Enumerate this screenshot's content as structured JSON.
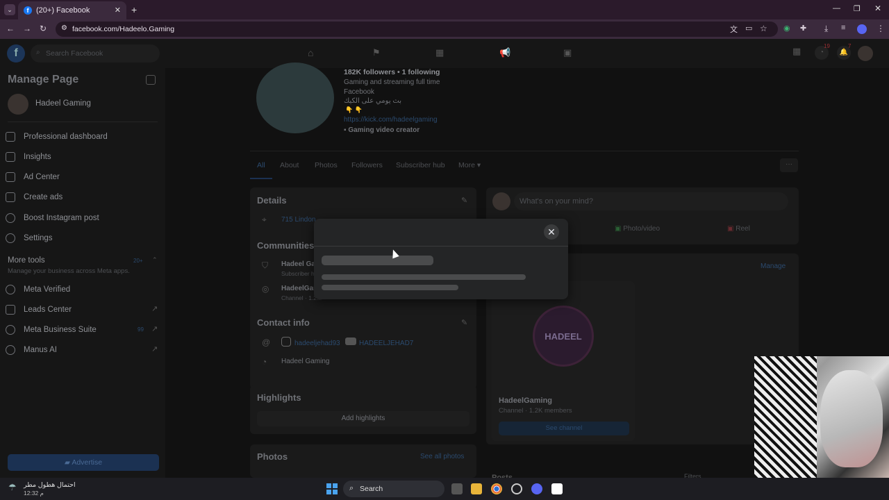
{
  "browser": {
    "tab_title": "(20+) Facebook",
    "url": "facebook.com/Hadeelo.Gaming"
  },
  "fb": {
    "search_placeholder": "Search Facebook",
    "notifications": {
      "messenger": "19",
      "bell": "7"
    }
  },
  "sidebar": {
    "title": "Manage Page",
    "page_name": "Hadeel Gaming",
    "items": [
      {
        "label": "Professional dashboard"
      },
      {
        "label": "Insights"
      },
      {
        "label": "Ad Center"
      },
      {
        "label": "Create ads"
      },
      {
        "label": "Boost Instagram post"
      },
      {
        "label": "Settings"
      }
    ],
    "more_tools": "More tools",
    "more_tools_badge": "20+",
    "more_tools_sub": "Manage your business across Meta apps.",
    "tools": [
      {
        "label": "Meta Verified"
      },
      {
        "label": "Leads Center"
      },
      {
        "label": "Meta Business Suite",
        "badge": "99"
      },
      {
        "label": "Manus AI"
      }
    ],
    "advertise": "Advertise"
  },
  "profile": {
    "stats": "182K followers • 1 following",
    "bio1": "Gaming and streaming full time",
    "bio2": "Facebook",
    "bio3": "بث يومي على الكيك",
    "link": "https://kick.com/hadeelgaming",
    "category": "Gaming video creator"
  },
  "tabs": [
    "All",
    "About",
    "Photos",
    "Followers",
    "Subscriber hub",
    "More ▾"
  ],
  "details": {
    "title": "Details",
    "location": "715 Lindon...",
    "communities": "Communities",
    "comm1": "Hadeel Ga...",
    "comm1_sub": "Subscriber h...",
    "comm2": "HadeelGam...",
    "comm2_sub": "Channel · 1.2...",
    "contact": "Contact info",
    "insta": "hadeeljehad93",
    "youtube": "HADEELJEHAD7",
    "messenger": "Hadeel Gaming",
    "highlights": "Highlights",
    "add_highlights": "Add highlights",
    "photos": "Photos",
    "see_all": "See all photos"
  },
  "composer": {
    "placeholder": "What's on your mind?",
    "photo": "Photo/video",
    "reel": "Reel"
  },
  "channels": {
    "manage": "Manage",
    "name": "HadeelGaming",
    "sub": "Channel · 1.2K members",
    "btn": "See channel",
    "logo_text": "HADEEL"
  },
  "bottom": {
    "posts": "Posts",
    "filters": "Filters"
  },
  "taskbar": {
    "weather": "احتمال هطول مطر",
    "time": "12:32 م",
    "search": "Search"
  }
}
